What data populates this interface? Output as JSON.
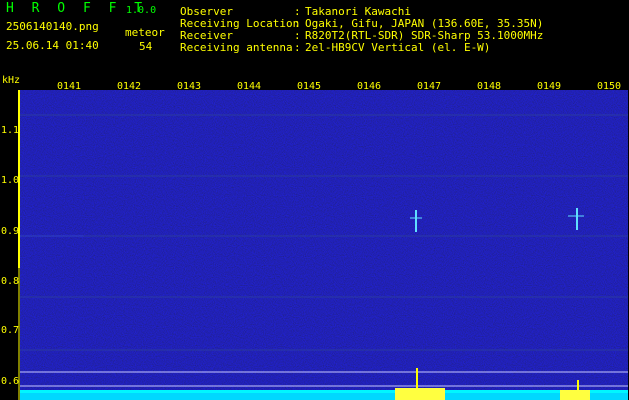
{
  "app": {
    "title": "H R O F F T",
    "version": "1.0.0"
  },
  "file": {
    "name": "2506140140.png",
    "timestamp": "25.06.14 01:40"
  },
  "meteor": {
    "label": "meteor",
    "count": "54"
  },
  "info": [
    {
      "label": "Observer",
      "value": "Takanori Kawachi"
    },
    {
      "label": "Receiving Location",
      "value": "Ogaki, Gifu, JAPAN (136.60E, 35.35N)"
    },
    {
      "label": "Receiver",
      "value": "R820T2(RTL-SDR) SDR-Sharp 53.1000MHz"
    },
    {
      "label": "Receiving antenna",
      "value": "2el-HB9CV Vertical (el. E-W)"
    }
  ],
  "axes": {
    "y_unit": "kHz",
    "x_ticks": [
      "0141",
      "0142",
      "0143",
      "0144",
      "0145",
      "0146",
      "0147",
      "0148",
      "0149",
      "0150"
    ],
    "y_ticks": [
      "1.1",
      "1.0",
      "0.9",
      "0.8",
      "0.7",
      "0.6"
    ]
  },
  "colors": {
    "text": "#ffff00",
    "title": "#00ff00",
    "background_noise": "#0a0a6e",
    "carrier": "#40c0ff",
    "histogram": "#00ffff",
    "meteor_echo": "#ffff00"
  }
}
